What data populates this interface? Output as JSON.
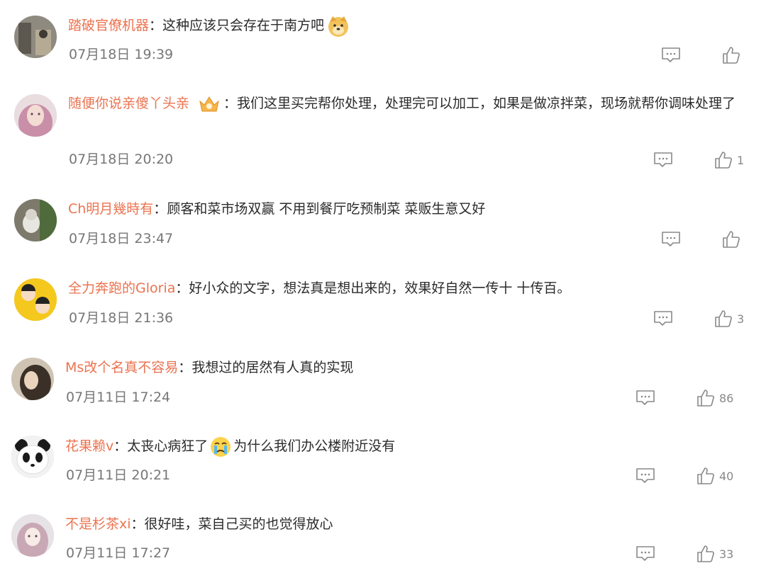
{
  "comments": [
    {
      "user": "踏破官僚机器",
      "sep": "：",
      "text": "这种应该只会存在于南方吧",
      "time": "07月18日 19:39",
      "likes": ""
    },
    {
      "user": "随便你说亲傻丫头亲",
      "sep": "：",
      "text": "我们这里买完帮你处理，处理完可以加工，如果是做凉拌菜，现场就帮你调味处理了",
      "time": "07月18日 20:20",
      "likes": "1"
    },
    {
      "user": "Ch明月幾時有",
      "sep": "：",
      "text": "顾客和菜市场双赢 不用到餐厅吃预制菜 菜贩生意又好",
      "time": "07月18日 23:47",
      "likes": ""
    },
    {
      "user": "全力奔跑的Gloria",
      "sep": "：",
      "text": "好小众的文字，想法真是想出来的，效果好自然一传十 十传百。",
      "time": "07月18日 21:36",
      "likes": "3"
    },
    {
      "user": "Ms改个名真不容易",
      "sep": "：",
      "text": "我想过的居然有人真的实现",
      "time": "07月11日 17:24",
      "likes": "86"
    },
    {
      "user": "花果赖v",
      "sep": "：",
      "text_a": "太丧心病狂了",
      "text_b": "为什么我们办公楼附近没有",
      "time": "07月11日 20:21",
      "likes": "40"
    },
    {
      "user": "不是杉茶xi",
      "sep": "：",
      "text": "很好哇，菜自己买的也觉得放心",
      "time": "07月11日 17:27",
      "likes": "33"
    }
  ],
  "icons": {
    "reply": "comment-icon",
    "like": "thumbs-up-icon"
  },
  "colors": {
    "username": "#eb7350",
    "text": "#2b2b2b",
    "time": "#777777",
    "icon": "#888888"
  }
}
